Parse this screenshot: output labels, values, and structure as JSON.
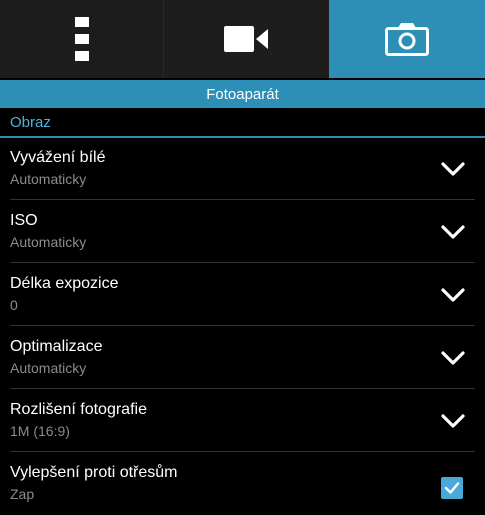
{
  "tabs": [
    {
      "icon": "settings-menu-icon"
    },
    {
      "icon": "video-camera-icon"
    },
    {
      "icon": "camera-icon",
      "active": true
    }
  ],
  "header": {
    "title": "Fotoaparát"
  },
  "section": {
    "title": "Obraz"
  },
  "settings": [
    {
      "title": "Vyvážení bílé",
      "value": "Automaticky",
      "control": "chevron-down-icon"
    },
    {
      "title": "ISO",
      "value": "Automaticky",
      "control": "chevron-down-icon"
    },
    {
      "title": "Délka expozice",
      "value": "0",
      "control": "chevron-down-icon"
    },
    {
      "title": "Optimalizace",
      "value": "Automaticky",
      "control": "chevron-down-icon"
    },
    {
      "title": "Rozlišení fotografie",
      "value": "1M (16:9)",
      "control": "chevron-down-icon"
    },
    {
      "title": "Vylepšení proti otřesům",
      "value": "Zap",
      "control": "checkbox",
      "checked": true
    }
  ],
  "colors": {
    "accent": "#2d8fb5",
    "section": "#4fb3d9",
    "checkbox": "#4aa9d8",
    "background": "#000000",
    "tabbar": "#1d1d1d"
  }
}
